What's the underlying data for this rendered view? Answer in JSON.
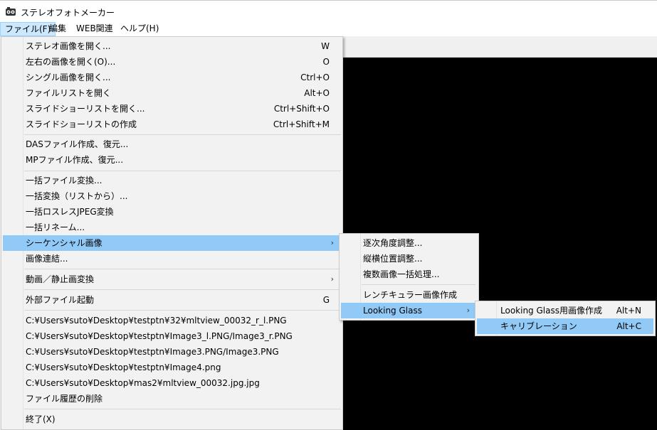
{
  "window": {
    "title": "ステレオフォトメーカー"
  },
  "menubar": {
    "items": [
      "ファイル(F)",
      "編集",
      "WEB関連",
      "ヘルプ(H)"
    ]
  },
  "file_menu": {
    "items": [
      {
        "label": "ステレオ画像を開く...",
        "shortcut": "W"
      },
      {
        "label": "左右の画像を開く(O)...",
        "shortcut": "O"
      },
      {
        "label": "シングル画像を開く...",
        "shortcut": "Ctrl+O"
      },
      {
        "label": "ファイルリストを開く",
        "shortcut": "Alt+O"
      },
      {
        "label": "スライドショーリストを開く...",
        "shortcut": "Ctrl+Shift+O"
      },
      {
        "label": "スライドショーリストの作成",
        "shortcut": "Ctrl+Shift+M"
      },
      {
        "label": "DASファイル作成、復元...",
        "shortcut": ""
      },
      {
        "label": "MPファイル作成、復元...",
        "shortcut": ""
      },
      {
        "label": "一括ファイル変換...",
        "shortcut": ""
      },
      {
        "label": "一括変換（リストから）...",
        "shortcut": ""
      },
      {
        "label": "一括ロスレスJPEG変換",
        "shortcut": ""
      },
      {
        "label": "一括リネーム...",
        "shortcut": ""
      },
      {
        "label": "シーケンシャル画像",
        "shortcut": ""
      },
      {
        "label": "画像連結...",
        "shortcut": ""
      },
      {
        "label": "動画／静止画変換",
        "shortcut": ""
      },
      {
        "label": "外部ファイル起動",
        "shortcut": "G"
      },
      {
        "label": "C:¥Users¥suto¥Desktop¥testptn¥32¥mltview_00032_r_l.PNG",
        "shortcut": ""
      },
      {
        "label": "C:¥Users¥suto¥Desktop¥testptn¥Image3_l.PNG/Image3_r.PNG",
        "shortcut": ""
      },
      {
        "label": "C:¥Users¥suto¥Desktop¥testptn¥Image3.PNG/Image3.PNG",
        "shortcut": ""
      },
      {
        "label": "C:¥Users¥suto¥Desktop¥testptn¥Image4.png",
        "shortcut": ""
      },
      {
        "label": "C:¥Users¥suto¥Desktop¥mas2¥mltview_00032.jpg.jpg",
        "shortcut": ""
      },
      {
        "label": "ファイル履歴の削除",
        "shortcut": ""
      },
      {
        "label": "終了(X)",
        "shortcut": ""
      }
    ]
  },
  "sequential_submenu": {
    "items": [
      {
        "label": "逐次角度調整..."
      },
      {
        "label": "縦横位置調整..."
      },
      {
        "label": "複数画像一括処理..."
      },
      {
        "label": "レンチキュラー画像作成"
      },
      {
        "label": "Looking Glass"
      }
    ]
  },
  "looking_glass_submenu": {
    "items": [
      {
        "label": "Looking Glass用画像作成",
        "shortcut": "Alt+N"
      },
      {
        "label": "キャリブレーション",
        "shortcut": "Alt+C"
      }
    ]
  },
  "colors": {
    "highlight": "#91c9f7",
    "viewer": "#000000"
  }
}
